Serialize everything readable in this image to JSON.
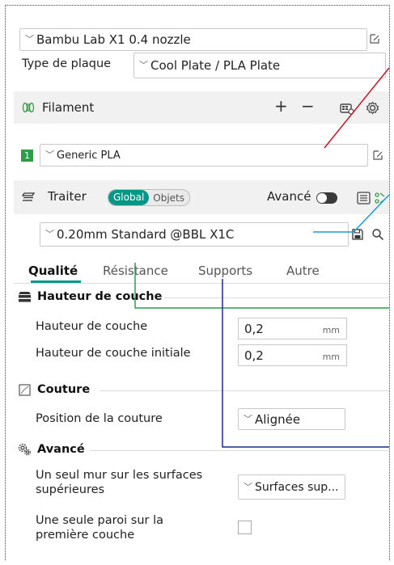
{
  "printer": {
    "selected": "Bambu Lab X1 0.4 nozzle"
  },
  "plate": {
    "label": "Type de plaque",
    "selected": "Cool Plate / PLA Plate"
  },
  "filament": {
    "title": "Filament",
    "add_symbol": "+",
    "remove_symbol": "−",
    "slot_number": "1",
    "selected": "Generic PLA"
  },
  "process": {
    "title": "Traiter",
    "toggle_global": "Global",
    "toggle_objects": "Objets",
    "advanced_label": "Avancé",
    "preset": "0.20mm Standard @BBL X1C"
  },
  "tabs": [
    "Qualité",
    "Résistance",
    "Supports",
    "Autre"
  ],
  "sections": {
    "layer_height": {
      "title": "Hauteur de couche",
      "layer_height_label": "Hauteur de couche",
      "layer_height_value": "0,2",
      "initial_layer_height_label": "Hauteur de couche initiale",
      "initial_layer_height_value": "0,2",
      "unit": "mm"
    },
    "seam": {
      "title": "Couture",
      "position_label": "Position de la couture",
      "position_value": "Alignée"
    },
    "advanced": {
      "title": "Avancé",
      "single_wall_top_label_line1": "Un seul mur sur les surfaces",
      "single_wall_top_label_line2": "supérieures",
      "single_wall_top_value": "Surfaces sup...",
      "single_wall_first_label_line1": "Une seule paroi sur la",
      "single_wall_first_label_line2": "première couche"
    }
  },
  "colors": {
    "accent": "#009688",
    "slot_green": "#2e9d45",
    "annotation_red": "#c0182a",
    "annotation_blue": "#1a9bd7",
    "annotation_green": "#2e9d45",
    "annotation_navy": "#1b2a8c"
  }
}
